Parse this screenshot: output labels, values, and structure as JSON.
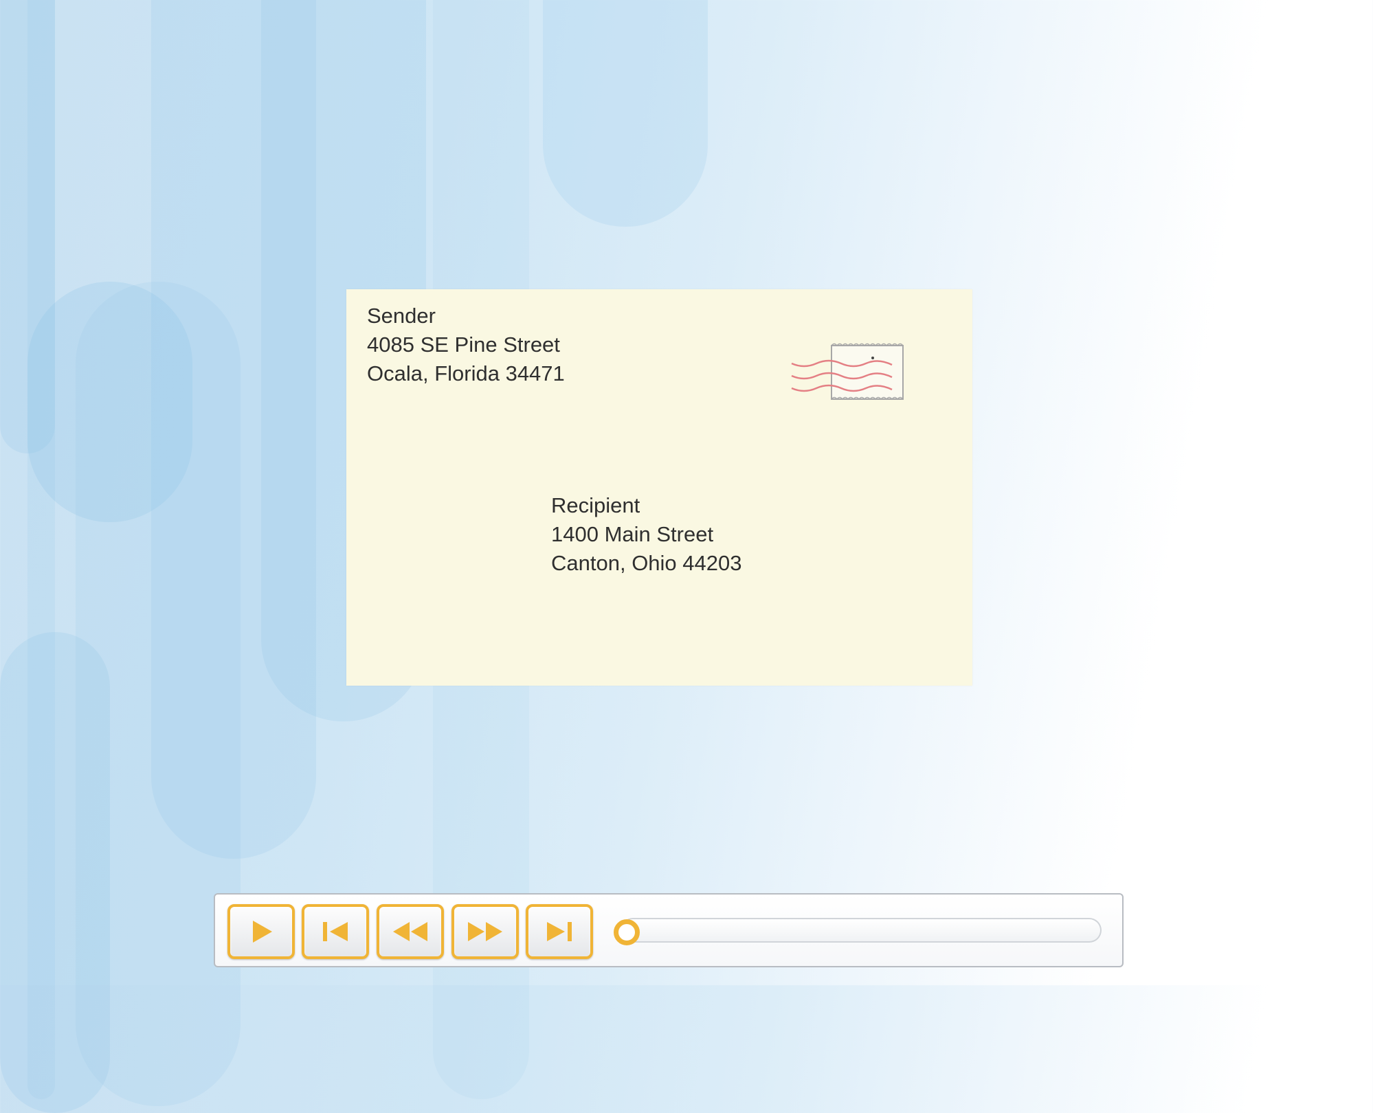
{
  "envelope": {
    "sender": {
      "name": "Sender",
      "street": "4085 SE Pine Street",
      "city": "Ocala, Florida 34471"
    },
    "recipient": {
      "name": "Recipient",
      "street": "1400 Main Street",
      "city": "Canton, Ohio 44203"
    },
    "stamp_icon": "postage-stamp-with-postmark"
  },
  "player": {
    "buttons": [
      {
        "icon": "play-icon"
      },
      {
        "icon": "skip-to-start-icon"
      },
      {
        "icon": "rewind-icon"
      },
      {
        "icon": "fast-forward-icon"
      },
      {
        "icon": "skip-to-end-icon"
      }
    ],
    "progress": 0,
    "accent_color": "#f0b436",
    "icon_color": "#f0b436"
  },
  "colors": {
    "envelope_bg": "#faf8e2",
    "text": "#2f2f2f",
    "postmark": "#e47f84"
  }
}
